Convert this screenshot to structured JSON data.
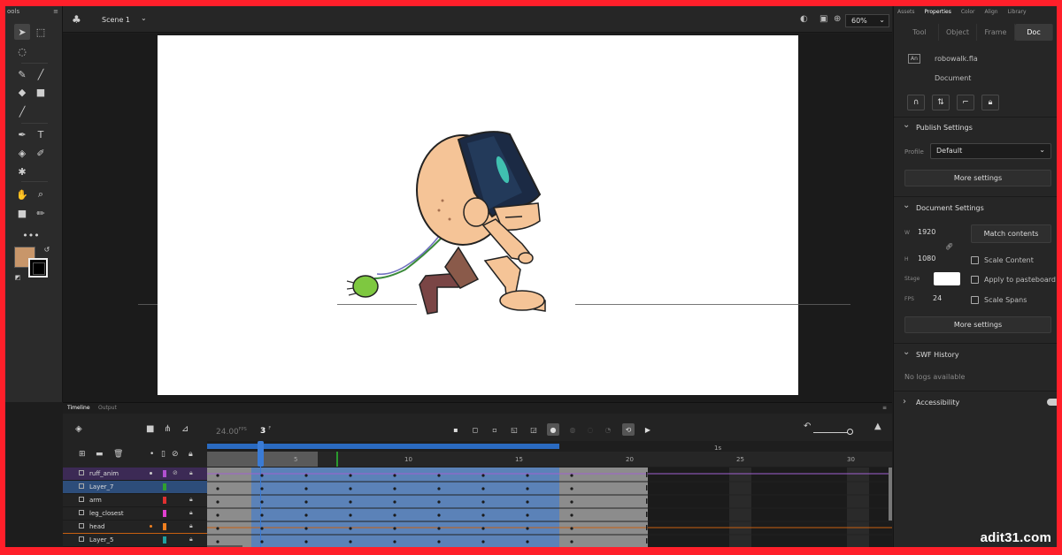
{
  "tools_panel": {
    "title": "ools"
  },
  "topbar": {
    "scene": "Scene 1",
    "zoom": "60%"
  },
  "right_panel": {
    "tabs": [
      "Assets",
      "Properties",
      "Color",
      "Align",
      "Library"
    ],
    "active_tab": "Properties",
    "sub_tabs": [
      "Tool",
      "Object",
      "Frame",
      "Doc"
    ],
    "active_sub_tab": "Doc",
    "file_name": "robowalk.fla",
    "doc_label": "Document",
    "publish": {
      "header": "Publish Settings",
      "profile_label": "Profile",
      "profile_value": "Default",
      "more": "More settings"
    },
    "doc_settings": {
      "header": "Document Settings",
      "w_label": "W",
      "w_value": "1920",
      "h_label": "H",
      "h_value": "1080",
      "match": "Match contents",
      "scale_content": "Scale Content",
      "stage_label": "Stage",
      "apply_paste": "Apply to pasteboard",
      "fps_label": "FPS",
      "fps_value": "24",
      "scale_spans": "Scale Spans",
      "more": "More settings"
    },
    "swf": {
      "header": "SWF History",
      "empty": "No logs available"
    },
    "accessibility": {
      "header": "Accessibility"
    }
  },
  "timeline": {
    "tabs": [
      "Timeline",
      "Output"
    ],
    "fps": "24.00",
    "fps_unit": "FPS",
    "current_frame": "3",
    "frame_unit": "F",
    "secs_marker": "1s",
    "frame_numbers": [
      "5",
      "10",
      "15",
      "20",
      "25",
      "30"
    ],
    "layers": [
      {
        "name": "ruff_anim",
        "color": "#b050d0"
      },
      {
        "name": "Layer_7",
        "color": "#30a030"
      },
      {
        "name": "arm",
        "color": "#e03030"
      },
      {
        "name": "leg_closest",
        "color": "#e040d0"
      },
      {
        "name": "head",
        "color": "#f08020"
      },
      {
        "name": "Layer_5",
        "color": "#20a0a0"
      }
    ]
  },
  "colors": {
    "fill": "#c8966a",
    "selection": "#2d4d7a",
    "playhead": "#3a7bd5"
  },
  "watermark": "adit31.com"
}
